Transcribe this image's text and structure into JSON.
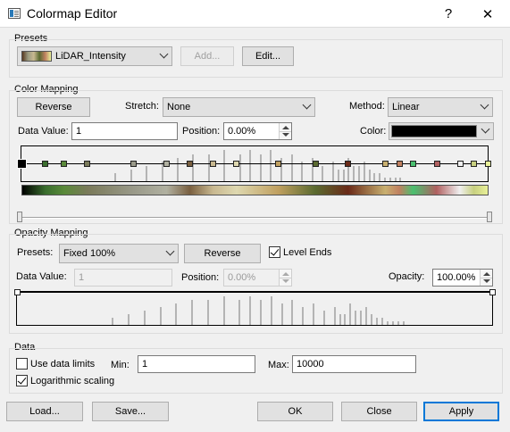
{
  "window": {
    "title": "Colormap Editor",
    "help_label": "?",
    "close_label": "✕"
  },
  "presets": {
    "group_title": "Presets",
    "selected": "LiDAR_Intensity",
    "add_label": "Add...",
    "edit_label": "Edit..."
  },
  "color_mapping": {
    "group_title": "Color Mapping",
    "reverse_label": "Reverse",
    "stretch_label": "Stretch:",
    "stretch_value": "None",
    "method_label": "Method:",
    "method_value": "Linear",
    "data_value_label": "Data Value:",
    "data_value": "1",
    "position_label": "Position:",
    "position_value": "0.00%",
    "color_label": "Color:",
    "color_value": "#000000",
    "nodes": [
      {
        "pos": 0.0,
        "color": "#000000"
      },
      {
        "pos": 0.05,
        "color": "#3a6e2e"
      },
      {
        "pos": 0.09,
        "color": "#5a8a3a"
      },
      {
        "pos": 0.14,
        "color": "#7a7a5a"
      },
      {
        "pos": 0.24,
        "color": "#9a9a8a"
      },
      {
        "pos": 0.31,
        "color": "#b0b0a0"
      },
      {
        "pos": 0.36,
        "color": "#7a6040"
      },
      {
        "pos": 0.41,
        "color": "#c8b890"
      },
      {
        "pos": 0.46,
        "color": "#ded8b0"
      },
      {
        "pos": 0.55,
        "color": "#c0a060"
      },
      {
        "pos": 0.63,
        "color": "#5a6a30"
      },
      {
        "pos": 0.7,
        "color": "#6a2a18"
      },
      {
        "pos": 0.78,
        "color": "#c8b070"
      },
      {
        "pos": 0.81,
        "color": "#c08060"
      },
      {
        "pos": 0.84,
        "color": "#4ac070"
      },
      {
        "pos": 0.89,
        "color": "#b06060"
      },
      {
        "pos": 0.94,
        "color": "#f0f0f0"
      },
      {
        "pos": 0.97,
        "color": "#c8d080"
      },
      {
        "pos": 1.0,
        "color": "#e8f098"
      }
    ]
  },
  "opacity_mapping": {
    "group_title": "Opacity Mapping",
    "presets_label": "Presets:",
    "presets_value": "Fixed 100%",
    "reverse_label": "Reverse",
    "level_ends_label": "Level Ends",
    "level_ends_checked": true,
    "data_value_label": "Data Value:",
    "data_value": "1",
    "position_label": "Position:",
    "position_value": "0.00%",
    "opacity_label": "Opacity:",
    "opacity_value": "100.00%"
  },
  "data_section": {
    "group_title": "Data",
    "use_limits_label": "Use data limits",
    "use_limits_checked": false,
    "min_label": "Min:",
    "min_value": "1",
    "max_label": "Max:",
    "max_value": "10000",
    "log_label": "Logarithmic scaling",
    "log_checked": true
  },
  "footer": {
    "load_label": "Load...",
    "save_label": "Save...",
    "ok_label": "OK",
    "close_label": "Close",
    "apply_label": "Apply"
  },
  "histogram": [
    0,
    0,
    0,
    0,
    0,
    0,
    0,
    0,
    0,
    0,
    0,
    0,
    0,
    0,
    0,
    0,
    0,
    0,
    2,
    0,
    0,
    3,
    0,
    0,
    4,
    0,
    0,
    5,
    0,
    0,
    6,
    0,
    0,
    7,
    0,
    0,
    7,
    0,
    0,
    8,
    0,
    0,
    7,
    0,
    8,
    0,
    7,
    0,
    8,
    0,
    6,
    0,
    7,
    0,
    5,
    0,
    6,
    0,
    4,
    0,
    5,
    3,
    3,
    6,
    4,
    4,
    5,
    3,
    2,
    2,
    1,
    1,
    1,
    1,
    0,
    0,
    0,
    0,
    0,
    0,
    0,
    0,
    0,
    0,
    0,
    0,
    0,
    0,
    0,
    0
  ]
}
